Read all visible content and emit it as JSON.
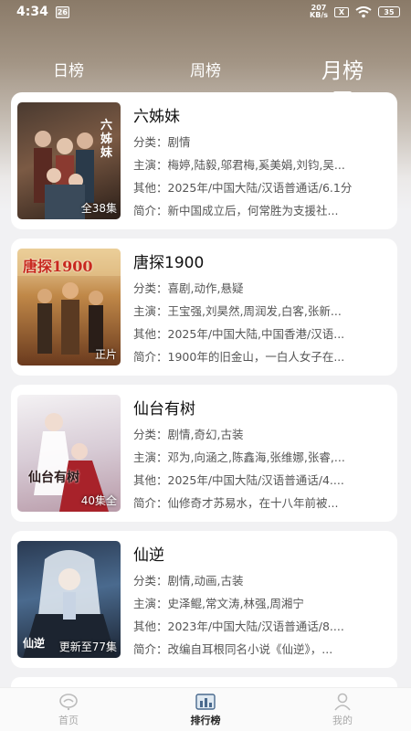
{
  "status": {
    "time": "4:34",
    "notif_badge": "26",
    "net_speed_top": "207",
    "net_speed_bottom": "KB/s",
    "sim_label": "X",
    "battery": "35"
  },
  "tabs": [
    {
      "label": "日榜",
      "active": false
    },
    {
      "label": "周榜",
      "active": false
    },
    {
      "label": "月榜",
      "active": true
    }
  ],
  "labels": {
    "category": "分类：",
    "cast": "主演：",
    "other": "其他：",
    "summary": "简介："
  },
  "items": [
    {
      "title": "六姊妹",
      "category": "剧情",
      "cast": "梅婷,陆毅,邬君梅,奚美娟,刘钧,吴...",
      "other": "2025年/中国大陆/汉语普通话/6.1分",
      "summary": "新中国成立后，何常胜为支援社...",
      "badge": "全38集",
      "poster_text": "六姊妹",
      "colors": [
        "#3a2a22",
        "#7b5a44",
        "#c9a48a"
      ]
    },
    {
      "title": "唐探1900",
      "category": "喜剧,动作,悬疑",
      "cast": "王宝强,刘昊然,周润发,白客,张新...",
      "other": "2025年/中国大陆,中国香港/汉语...",
      "summary": "1900年的旧金山，一白人女子在...",
      "badge": "正片",
      "poster_text": "唐探1900",
      "colors": [
        "#6a3a1e",
        "#b07a3e",
        "#e8c07a"
      ]
    },
    {
      "title": "仙台有树",
      "category": "剧情,奇幻,古装",
      "cast": "邓为,向涵之,陈鑫海,张维娜,张睿,...",
      "other": "2025年/中国大陆/汉语普通话/4....",
      "summary": "仙修奇才苏易水，在十八年前被...",
      "badge": "40集全",
      "poster_text": "仙台有树",
      "colors": [
        "#e8e6ea",
        "#c8b8c4",
        "#8a2a30"
      ]
    },
    {
      "title": "仙逆",
      "category": "剧情,动画,古装",
      "cast": "史泽鲲,常文涛,林强,周湘宁",
      "other": "2023年/中国大陆/汉语普通话/8....",
      "summary": "改编自耳根同名小说《仙逆》，...",
      "badge": "更新至77集",
      "poster_text": "仙逆",
      "colors": [
        "#1c2a3e",
        "#4a6a8e",
        "#c8d4e4"
      ]
    }
  ],
  "nav": [
    {
      "label": "首页",
      "icon": "home-icon",
      "active": false
    },
    {
      "label": "排行榜",
      "icon": "ranking-icon",
      "active": true
    },
    {
      "label": "我的",
      "icon": "profile-icon",
      "active": false
    }
  ]
}
